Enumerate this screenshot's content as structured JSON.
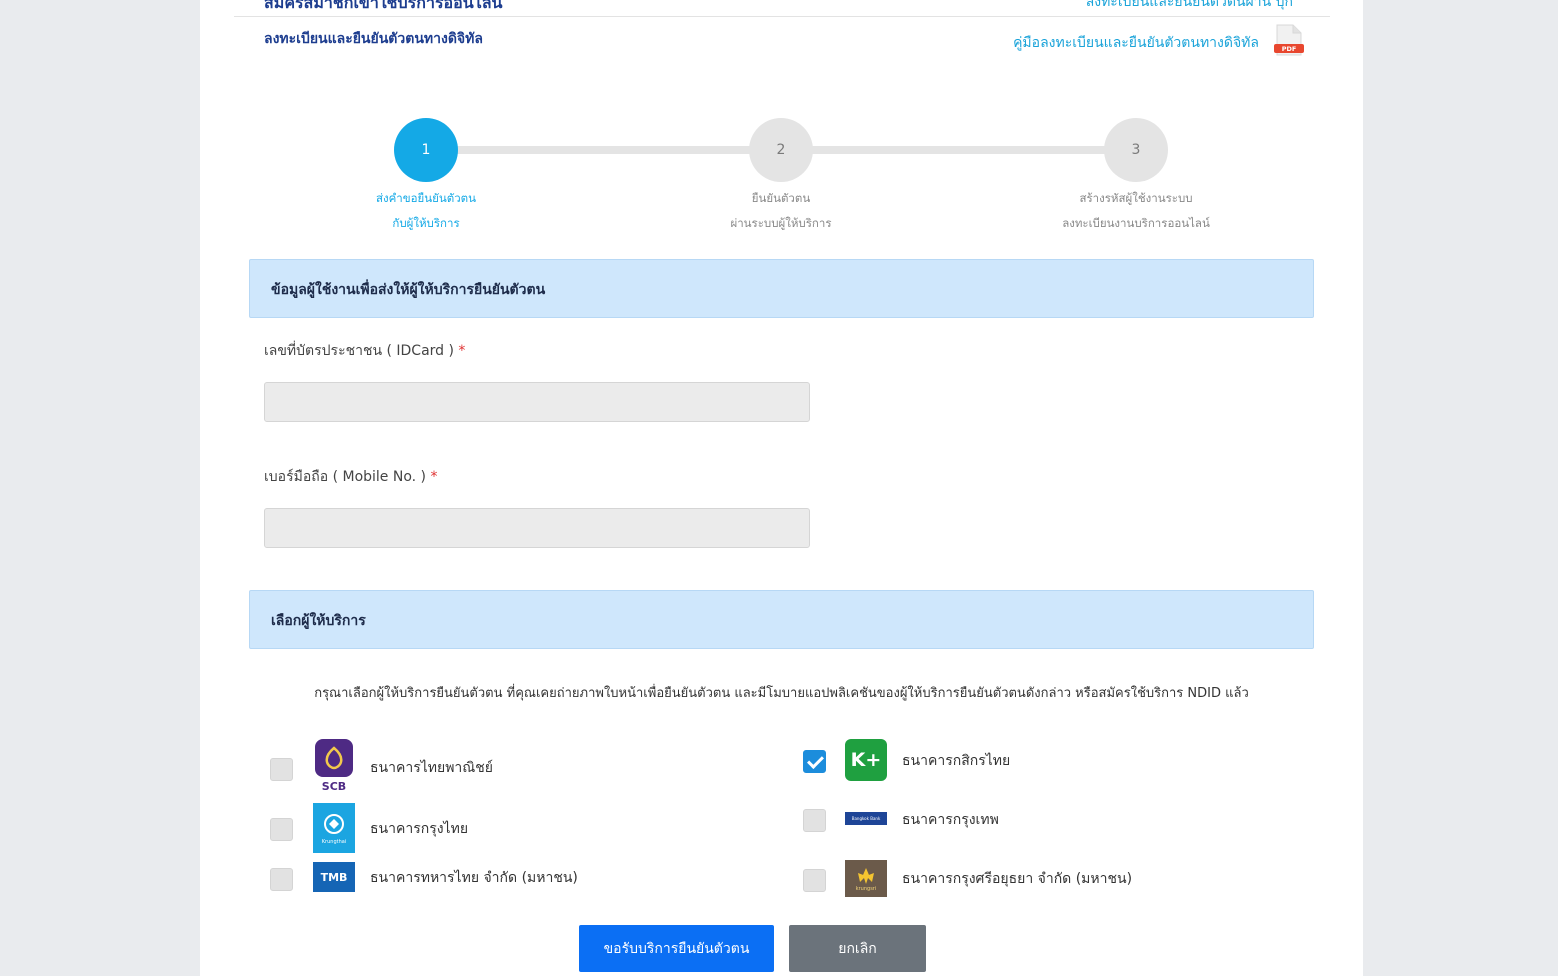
{
  "header": {
    "top_title_cut": "สมัครสมาชิกเข้าใช้บริการออนไลน์",
    "top_link_cut": "ลงทะเบียนและยืนยันตัวตนผ่าน บุ๊ก",
    "subtitle": "ลงทะเบียนและยืนยันตัวตนทางดิจิทัล",
    "manual_link": "คู่มือลงทะเบียนและยืนยันตัวตนทางดิจิทัล",
    "pdf_badge": "PDF"
  },
  "steps": [
    {
      "number": "1",
      "line1": "ส่งคำขอยืนยันตัวตน",
      "line2": "กับผู้ให้บริการ",
      "active": true
    },
    {
      "number": "2",
      "line1": "ยืนยันตัวตน",
      "line2": "ผ่านระบบผู้ให้บริการ",
      "active": false
    },
    {
      "number": "3",
      "line1": "สร้างรหัสผู้ใช้งานระบบ",
      "line2": "ลงทะเบียนงานบริการออนไลน์",
      "active": false
    }
  ],
  "user_section": {
    "title": "ข้อมูลผู้ใช้งานเพื่อส่งให้ผู้ให้บริการยืนยันตัวตน",
    "id_label": "เลขที่บัตรประชาชน ( IDCard )",
    "id_value": "",
    "mobile_label": "เบอร์มือถือ ( Mobile No. )",
    "mobile_value": "",
    "required_mark": "*"
  },
  "provider_section": {
    "title": "เลือกผู้ให้บริการ",
    "instruction": "กรุณาเลือกผู้ให้บริการยืนยันตัวตน ที่คุณเคยถ่ายภาพใบหน้าเพื่อยืนยันตัวตน และมีโมบายแอปพลิเคชันของผู้ให้บริการยืนยันตัวตนดังกล่าว หรือสมัครใช้บริการ NDID แล้ว",
    "providers": [
      {
        "name": "ธนาคารไทยพาณิชย์",
        "logo_text": "SCB",
        "checked": false,
        "color": "#4e2a84"
      },
      {
        "name": "ธนาคารกสิกรไทย",
        "logo_text": "K+",
        "checked": true,
        "color": "#1fa040"
      },
      {
        "name": "ธนาคารกรุงไทย",
        "logo_text": "Krungthai",
        "checked": false,
        "color": "#1ba5e1"
      },
      {
        "name": "ธนาคารกรุงเทพ",
        "logo_text": "Bangkok Bank",
        "checked": false,
        "color": "#1e4597"
      },
      {
        "name": "ธนาคารทหารไทย จำกัด (มหาชน)",
        "logo_text": "TMB",
        "checked": false,
        "color": "#1565b5"
      },
      {
        "name": "ธนาคารกรุงศรีอยุธยา จำกัด (มหาชน)",
        "logo_text": "krungsri",
        "checked": false,
        "color": "#6b5a4a"
      }
    ]
  },
  "actions": {
    "submit": "ขอรับบริการยืนยันตัวตน",
    "cancel": "ยกเลิก"
  }
}
